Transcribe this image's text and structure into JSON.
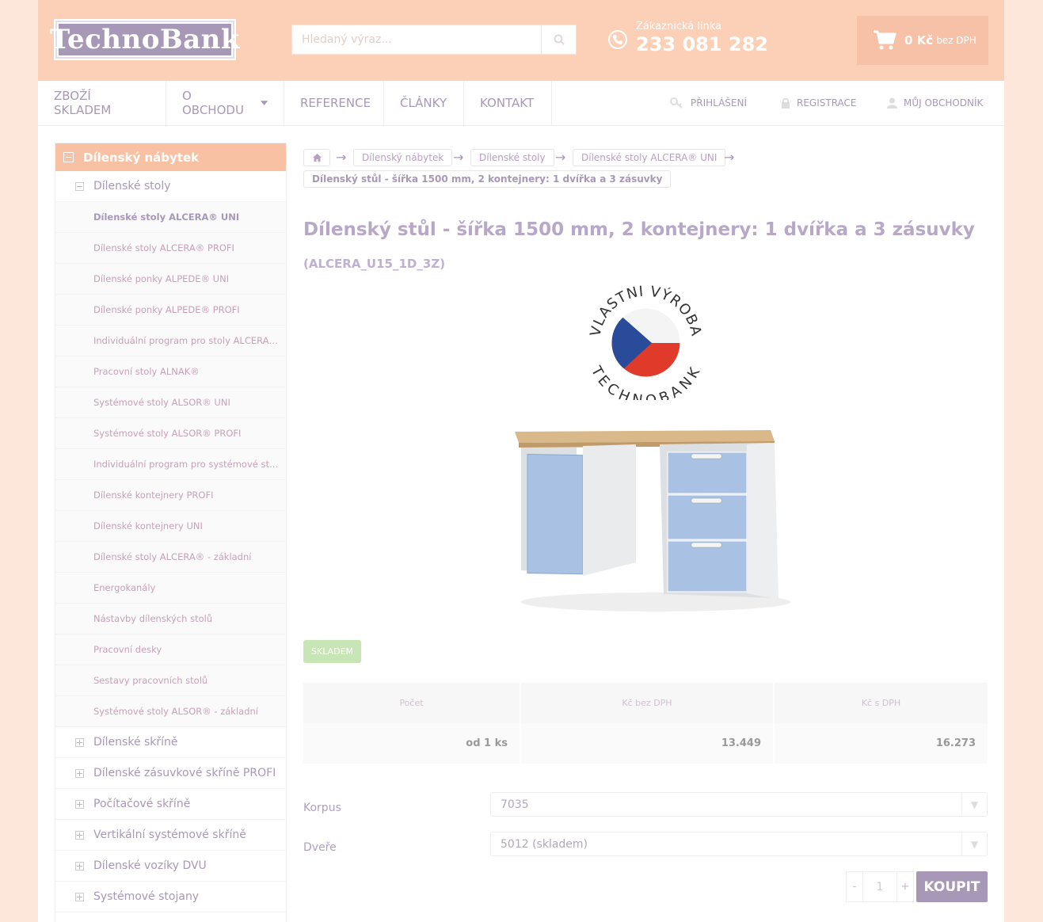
{
  "header": {
    "logo_text": "TechnoBank",
    "search_placeholder": "Hledaný výraz...",
    "phone_label": "Zákaznická linka",
    "phone_number": "233 081 282",
    "cart_amount": "0 Kč",
    "cart_vat": "bez DPH"
  },
  "nav": {
    "items": [
      "ZBOŽÍ SKLADEM",
      "O OBCHODU",
      "REFERENCE",
      "ČLÁNKY",
      "KONTAKT"
    ],
    "right": [
      "PŘIHLÁŠENÍ",
      "REGISTRACE",
      "MŮJ OBCHODNÍK"
    ]
  },
  "sidebar": {
    "head": "Dílenský nábytek",
    "sub": "Dílenské stoly",
    "items": [
      "Dílenské stoly ALCERA® UNI",
      "Dílenské stoly ALCERA® PROFI",
      "Dílenské ponky ALPEDE® UNI",
      "Dílenské ponky ALPEDE® PROFI",
      "Individuální program pro stoly ALCERA® UNI",
      "Pracovní stoly ALNAK®",
      "Systémové stoly ALSOR® UNI",
      "Systémové stoly ALSOR® PROFI",
      "Individuální program pro systémové stoly ALSOR®",
      "Dílenské kontejnery PROFI",
      "Dílenské kontejnery UNI",
      "Dílenské stoly ALCERA® - základní",
      "Energokanály",
      "Nástavby dílenských stolů",
      "Pracovní desky",
      "Sestavy pracovních stolů",
      "Systémové stoly ALSOR® - základní"
    ],
    "groups": [
      "Dílenské skříně",
      "Dílenské zásuvkové skříně PROFI",
      "Počítačové skříně",
      "Vertikální systémové skříně",
      "Dílenské vozíky DVU",
      "Systémové stojany"
    ]
  },
  "breadcrumb": {
    "items": [
      "Dílenský nábytek",
      "Dílenské stoly",
      "Dílenské stoly ALCERA® UNI"
    ],
    "current": "Dílenský stůl - šířka 1500 mm, 2 kontejnery: 1 dvířka a 3 zásuvky"
  },
  "product": {
    "title": "Dílenský stůl - šířka 1500 mm, 2 kontejnery: 1 dvířka a 3 zásuvky",
    "code": "(ALCERA_U15_1D_3Z)",
    "stamp_top": "VLASTNÍ VÝROBA",
    "stamp_bottom": "TECHNOBANK",
    "stock": "SKLADEM"
  },
  "price_table": {
    "headers": [
      "Počet",
      "Kč bez DPH",
      "Kč s DPH"
    ],
    "row": [
      "od 1 ks",
      "13.449",
      "16.273"
    ]
  },
  "options": {
    "korpus_label": "Korpus",
    "korpus_value": "7035",
    "dvere_label": "Dveře",
    "dvere_value": "5012 (skladem)"
  },
  "buy": {
    "minus": "-",
    "qty": "1",
    "plus": "+",
    "button": "KOUPIT"
  },
  "colors": {
    "header_bg": "#fbd0b6",
    "accent": "#a898b8",
    "stock": "#c7e5b5"
  }
}
